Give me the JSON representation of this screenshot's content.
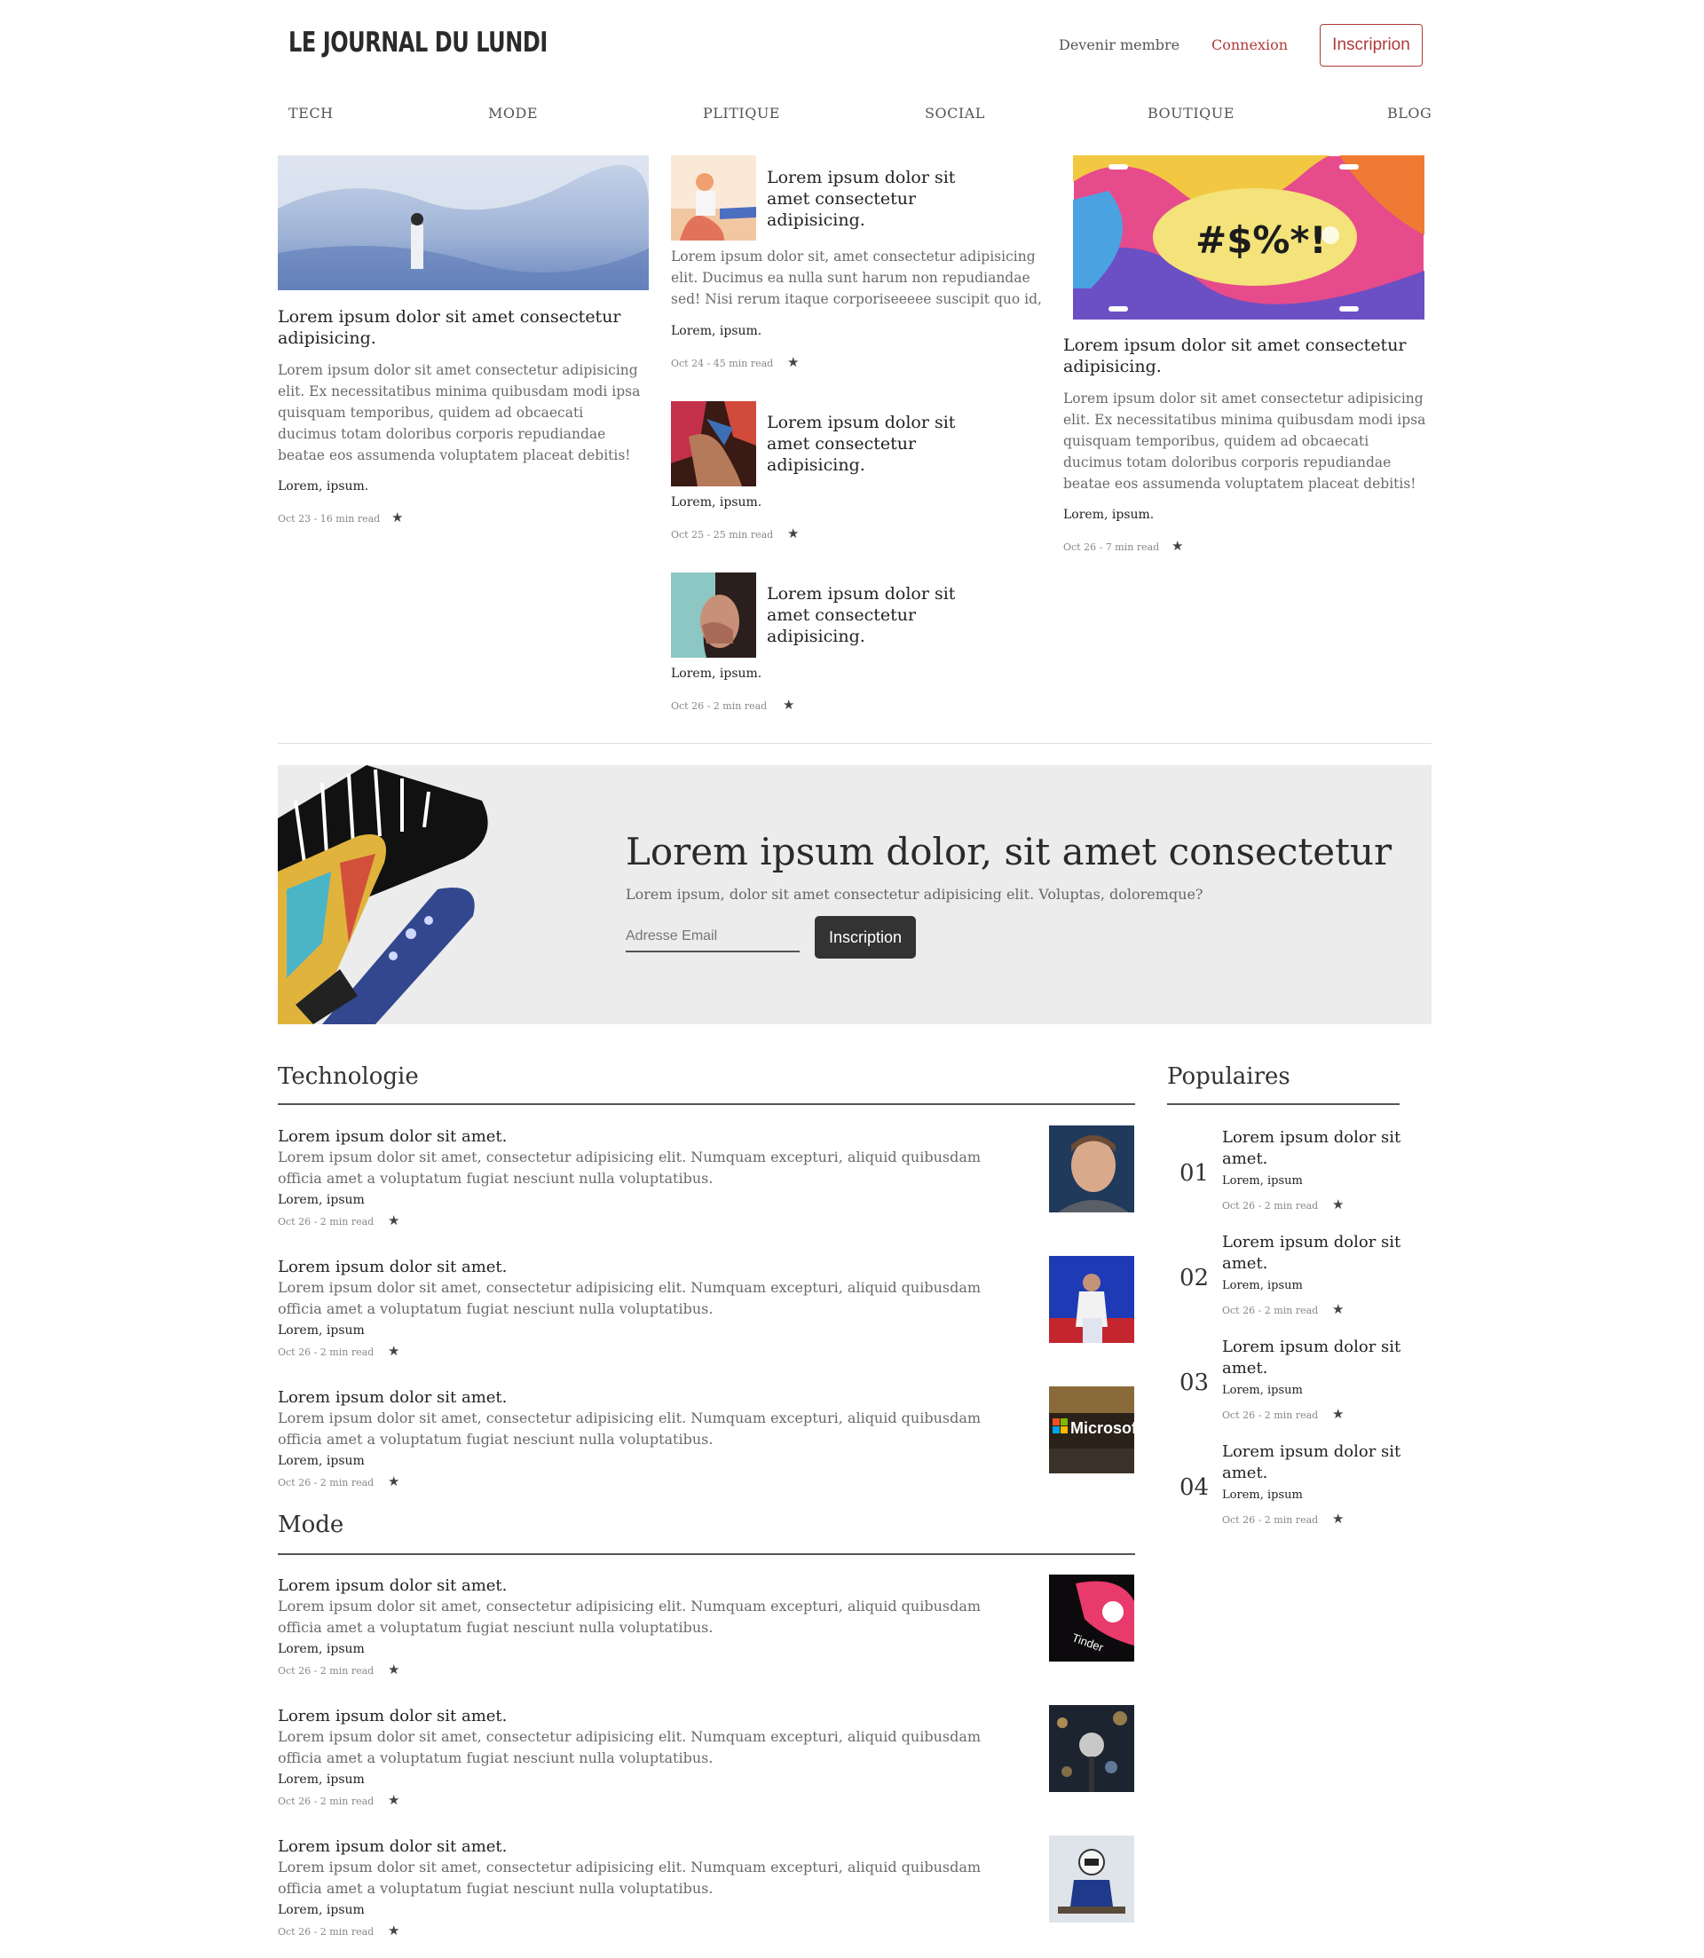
{
  "header": {
    "logo": "LE JOURNAL DU LUNDI",
    "become_member": "Devenir membre",
    "login": "Connexion",
    "signup": "Inscriprion"
  },
  "nav": [
    "TECH",
    "MODE",
    "PLITIQUE",
    "SOCIAL",
    "BOUTIQUE",
    "BLOG"
  ],
  "hero": {
    "left": {
      "title": "Lorem ipsum dolor sit amet consectetur adipisicing.",
      "text": "Lorem ipsum dolor sit amet consectetur adipisicing elit. Ex necessitatibus minima quibusdam modi ipsa quisquam temporibus, quidem ad obcaecati ducimus totam doloribus corporis repudiandae beatae eos assumenda voluptatem placeat debitis!",
      "author": "Lorem, ipsum.",
      "meta": "Oct 23 - 16 min read"
    },
    "middle": [
      {
        "title": "Lorem ipsum dolor sit amet consectetur adipisicing.",
        "text": "Lorem ipsum dolor sit, amet consectetur adipisicing elit. Ducimus ea nulla sunt harum non repudiandae sed! Nisi rerum itaque corporiseeeee suscipit quo id,",
        "author": "Lorem, ipsum.",
        "meta": "Oct 24 - 45 min read"
      },
      {
        "title": "Lorem ipsum dolor sit amet consectetur adipisicing.",
        "author": "Lorem, ipsum.",
        "meta": "Oct 25 - 25 min read"
      },
      {
        "title": "Lorem ipsum dolor sit amet consectetur adipisicing.",
        "author": "Lorem, ipsum.",
        "meta": "Oct 26 - 2 min read"
      }
    ],
    "right": {
      "plate_text": "#$%*!",
      "title": "Lorem ipsum dolor sit amet consectetur adipisicing.",
      "text": "Lorem ipsum dolor sit amet consectetur adipisicing elit. Ex necessitatibus minima quibusdam modi ipsa quisquam temporibus, quidem ad obcaecati ducimus totam doloribus corporis repudiandae beatae eos assumenda voluptatem placeat debitis!",
      "author": "Lorem, ipsum.",
      "meta": "Oct 26 - 7 min read"
    }
  },
  "newsletter": {
    "title": "Lorem ipsum dolor, sit amet consectetur",
    "subtitle": "Lorem ipsum, dolor sit amet consectetur adipisicing elit. Voluptas, doloremque?",
    "email_placeholder": "Adresse Email",
    "button": "Inscription"
  },
  "technologie": {
    "title": "Technologie",
    "items": [
      {
        "title": "Lorem ipsum dolor sit amet.",
        "text": "Lorem ipsum dolor sit amet, consectetur adipisicing elit. Numquam excepturi, aliquid quibusdam officia amet a voluptatum fugiat nesciunt nulla voluptatibus.",
        "author": "Lorem, ipsum",
        "meta": "Oct 26 - 2 min read"
      },
      {
        "title": "Lorem ipsum dolor sit amet.",
        "text": "Lorem ipsum dolor sit amet, consectetur adipisicing elit. Numquam excepturi, aliquid quibusdam officia amet a voluptatum fugiat nesciunt nulla voluptatibus.",
        "author": "Lorem, ipsum",
        "meta": "Oct 26 - 2 min read"
      },
      {
        "title": "Lorem ipsum dolor sit amet.",
        "text": "Lorem ipsum dolor sit amet, consectetur adipisicing elit. Numquam excepturi, aliquid quibusdam officia amet a voluptatum fugiat nesciunt nulla voluptatibus.",
        "author": "Lorem, ipsum",
        "meta": "Oct 26 - 2 min read",
        "thumb_text": "Microsoft"
      }
    ]
  },
  "mode": {
    "title": "Mode",
    "items": [
      {
        "title": "Lorem ipsum dolor sit amet.",
        "text": "Lorem ipsum dolor sit amet, consectetur adipisicing elit. Numquam excepturi, aliquid quibusdam officia amet a voluptatum fugiat nesciunt nulla voluptatibus.",
        "author": "Lorem, ipsum",
        "meta": "Oct 26 - 2 min read",
        "thumb_text": "Tinder"
      },
      {
        "title": "Lorem ipsum dolor sit amet.",
        "text": "Lorem ipsum dolor sit amet, consectetur adipisicing elit. Numquam excepturi, aliquid quibusdam officia amet a voluptatum fugiat nesciunt nulla voluptatibus.",
        "author": "Lorem, ipsum",
        "meta": "Oct 26 - 2 min read"
      },
      {
        "title": "Lorem ipsum dolor sit amet.",
        "text": "Lorem ipsum dolor sit amet, consectetur adipisicing elit. Numquam excepturi, aliquid quibusdam officia amet a voluptatum fugiat nesciunt nulla voluptatibus.",
        "author": "Lorem, ipsum",
        "meta": "Oct 26 - 2 min read"
      }
    ]
  },
  "populaires": {
    "title": "Populaires",
    "items": [
      {
        "num": "01",
        "title": "Lorem ipsum dolor sit amet.",
        "author": "Lorem, ipsum",
        "meta": "Oct 26 - 2 min read"
      },
      {
        "num": "02",
        "title": "Lorem ipsum dolor sit amet.",
        "author": "Lorem, ipsum",
        "meta": "Oct 26 - 2 min read"
      },
      {
        "num": "03",
        "title": "Lorem ipsum dolor sit amet.",
        "author": "Lorem, ipsum",
        "meta": "Oct 26 - 2 min read"
      },
      {
        "num": "04",
        "title": "Lorem ipsum dolor sit amet.",
        "author": "Lorem, ipsum",
        "meta": "Oct 26 - 2 min read"
      }
    ]
  },
  "icons": {
    "star": "star-icon"
  },
  "colors": {
    "accent": "#b03a3a",
    "dark_button": "#333333",
    "newsletter_bg": "#ececec"
  }
}
